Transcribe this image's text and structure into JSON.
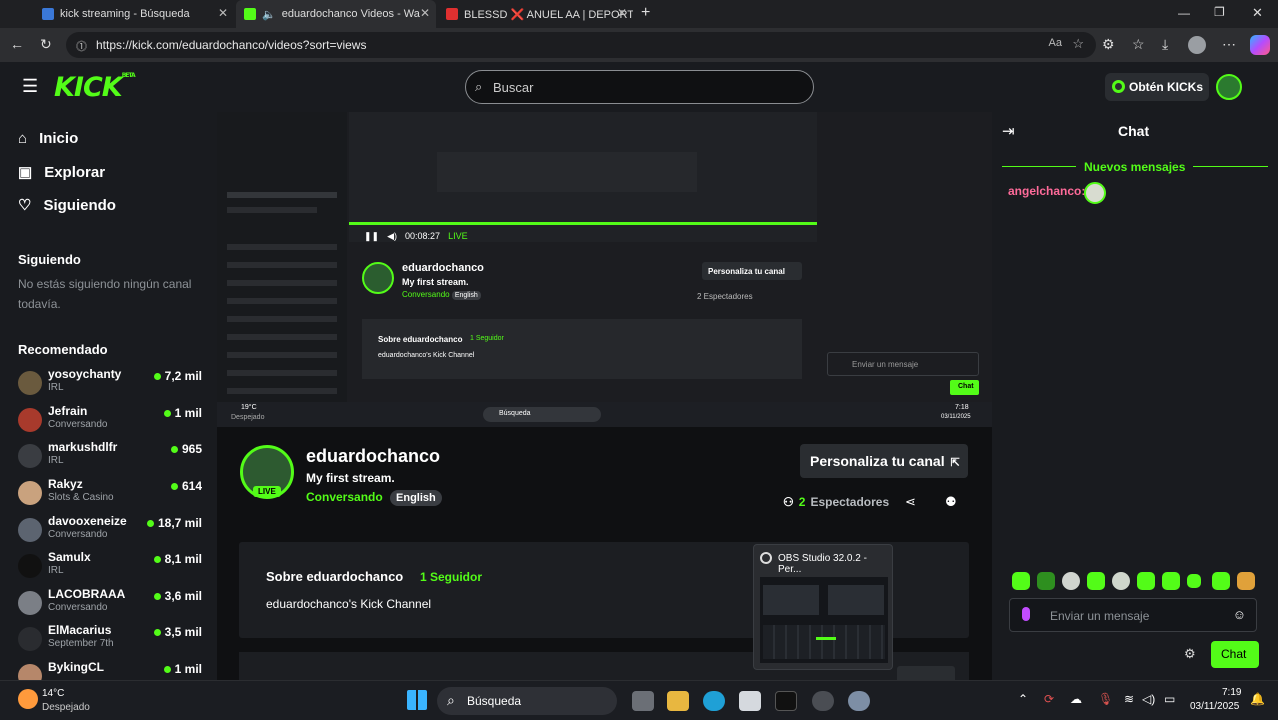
{
  "browser": {
    "tabs": [
      {
        "title": "kick streaming - Búsqueda"
      },
      {
        "title": "eduardochanco Videos - Wa"
      },
      {
        "title": "BLESSD ❌ ANUEL AA | DEPORTI"
      }
    ],
    "url": "https://kick.com/eduardochanco/videos?sort=views"
  },
  "header": {
    "logo": "KICK",
    "beta": "BETA",
    "search_placeholder": "Buscar",
    "get_kicks": "Obtén KICKs"
  },
  "sidebar": {
    "nav": [
      {
        "label": "Inicio"
      },
      {
        "label": "Explorar"
      },
      {
        "label": "Siguiendo"
      }
    ],
    "following_title": "Siguiendo",
    "following_empty": "No estás siguiendo ningún canal todavía.",
    "recommended_title": "Recomendado",
    "recommended": [
      {
        "name": "yosoychanty",
        "category": "IRL",
        "viewers": "7,2 mil"
      },
      {
        "name": "Jefrain",
        "category": "Conversando",
        "viewers": "1 mil"
      },
      {
        "name": "markushdlfr",
        "category": "IRL",
        "viewers": "965"
      },
      {
        "name": "Rakyz",
        "category": "Slots & Casino",
        "viewers": "614"
      },
      {
        "name": "davooxeneize",
        "category": "Conversando",
        "viewers": "18,7 mil"
      },
      {
        "name": "Samulx",
        "category": "IRL",
        "viewers": "8,1 mil"
      },
      {
        "name": "LACOBRAAA",
        "category": "Conversando",
        "viewers": "3,6 mil"
      },
      {
        "name": "ElMacarius",
        "category": "September 7th",
        "viewers": "3,5 mil"
      },
      {
        "name": "BykingCL",
        "category": "",
        "viewers": "1 mil"
      }
    ]
  },
  "player": {
    "time": "00:08:27",
    "live": "LIVE",
    "inner_channel": "eduardochanco",
    "inner_title": "My first stream.",
    "inner_category": "Conversando",
    "inner_lang": "English",
    "inner_customize": "Personaliza tu canal",
    "inner_viewers": "2 Espectadores",
    "inner_about": "Sobre eduardochanco",
    "inner_followers": "1 Seguidor",
    "inner_desc": "eduardochanco's Kick Channel",
    "inner_chat_placeholder": "Enviar un mensaje",
    "inner_chat_btn": "Chat",
    "inner_search": "Búsqueda",
    "inner_weather": "19°C",
    "inner_weather_desc": "Despejado",
    "inner_clock": "7:18",
    "inner_date": "03/11/2025"
  },
  "channel": {
    "name": "eduardochanco",
    "title": "My first stream.",
    "category": "Conversando",
    "language": "English",
    "live_badge": "LIVE",
    "customize": "Personaliza tu canal",
    "viewers_count": "2",
    "viewers_label": "Espectadores"
  },
  "about": {
    "title": "Sobre eduardochanco",
    "followers": "1 Seguidor",
    "description": "eduardochanco's Kick Channel"
  },
  "obs_preview": {
    "title": "OBS Studio 32.0.2 - Per..."
  },
  "chat": {
    "title": "Chat",
    "new_messages": "Nuevos mensajes",
    "messages": [
      {
        "user": "angelchanco:",
        "user_color": "#ff6b9a"
      }
    ],
    "input_placeholder": "Enviar un mensaje",
    "send_label": "Chat"
  },
  "taskbar": {
    "temperature": "14°C",
    "weather": "Despejado",
    "search": "Búsqueda",
    "time": "7:19",
    "date": "03/11/2025"
  },
  "colors": {
    "accent": "#53fc18",
    "bg": "#0f1012",
    "panel": "#191b1f"
  }
}
